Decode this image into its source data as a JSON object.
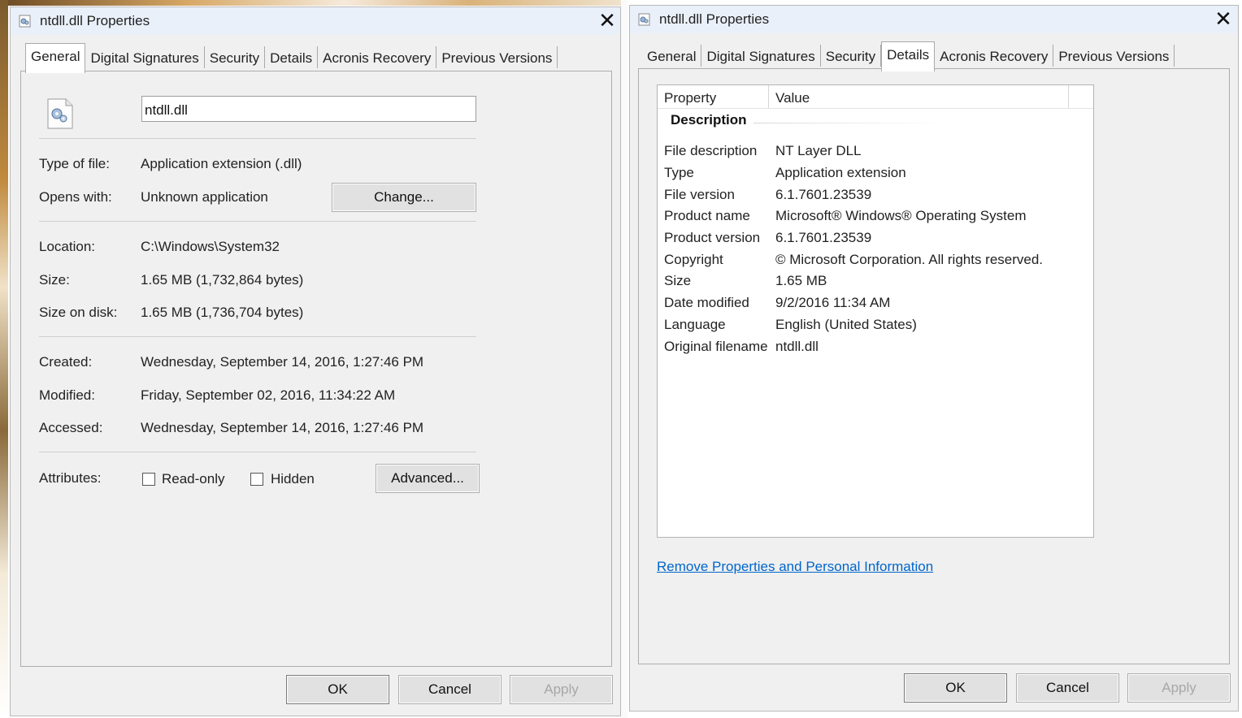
{
  "left_window": {
    "title": "ntdll.dll Properties",
    "close_glyph": "✕",
    "tabs": [
      "General",
      "Digital Signatures",
      "Security",
      "Details",
      "Acronis Recovery",
      "Previous Versions"
    ],
    "active_tab": "General",
    "file_name_value": "ntdll.dll",
    "type_of_file_label": "Type of file:",
    "type_of_file_value": "Application extension (.dll)",
    "opens_with_label": "Opens with:",
    "opens_with_value": "Unknown application",
    "change_button": "Change...",
    "location_label": "Location:",
    "location_value": "C:\\Windows\\System32",
    "size_label": "Size:",
    "size_value": "1.65 MB (1,732,864 bytes)",
    "size_on_disk_label": "Size on disk:",
    "size_on_disk_value": "1.65 MB (1,736,704 bytes)",
    "created_label": "Created:",
    "created_value": "Wednesday, September 14, 2016, 1:27:46 PM",
    "modified_label": "Modified:",
    "modified_value": "Friday, September 02, 2016, 11:34:22 AM",
    "accessed_label": "Accessed:",
    "accessed_value": "Wednesday, September 14, 2016, 1:27:46 PM",
    "attributes_label": "Attributes:",
    "readonly_label": "Read-only",
    "readonly_checked": false,
    "hidden_label": "Hidden",
    "hidden_checked": false,
    "advanced_button": "Advanced...",
    "ok_button": "OK",
    "cancel_button": "Cancel",
    "apply_button": "Apply",
    "apply_enabled": false
  },
  "right_window": {
    "title": "ntdll.dll Properties",
    "close_glyph": "✕",
    "tabs": [
      "General",
      "Digital Signatures",
      "Security",
      "Details",
      "Acronis Recovery",
      "Previous Versions"
    ],
    "active_tab": "Details",
    "columns": [
      "Property",
      "Value"
    ],
    "group": "Description",
    "rows": [
      {
        "name": "File description",
        "value": "NT Layer DLL"
      },
      {
        "name": "Type",
        "value": "Application extension"
      },
      {
        "name": "File version",
        "value": "6.1.7601.23539"
      },
      {
        "name": "Product name",
        "value": "Microsoft® Windows® Operating System"
      },
      {
        "name": "Product version",
        "value": "6.1.7601.23539"
      },
      {
        "name": "Copyright",
        "value": "© Microsoft Corporation. All rights reserved."
      },
      {
        "name": "Size",
        "value": "1.65 MB"
      },
      {
        "name": "Date modified",
        "value": "9/2/2016 11:34 AM"
      },
      {
        "name": "Language",
        "value": "English (United States)"
      },
      {
        "name": "Original filename",
        "value": "ntdll.dll"
      }
    ],
    "remove_link": "Remove Properties and Personal Information",
    "ok_button": "OK",
    "cancel_button": "Cancel",
    "apply_button": "Apply",
    "apply_enabled": false
  },
  "colors": {
    "titlebar": "#eaf0f9",
    "window_bg": "#f0f0f0",
    "link": "#0066cc"
  }
}
